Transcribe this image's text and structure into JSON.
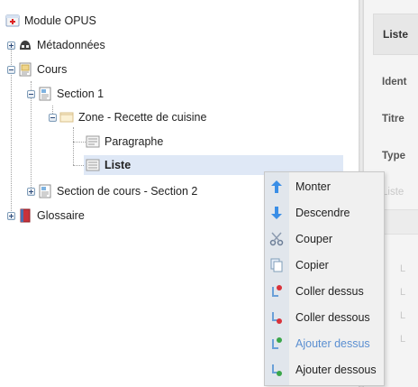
{
  "tree": {
    "root": "Module OPUS",
    "metadata": "Métadonnées",
    "cours": "Cours",
    "section1": "Section 1",
    "zone": "Zone - Recette de cuisine",
    "paragraphe": "Paragraphe",
    "liste": "Liste",
    "section2": "Section de cours - Section 2",
    "glossaire": "Glossaire"
  },
  "panel": {
    "header": "Liste",
    "field_ident": "Ident",
    "field_titre": "Titre",
    "field_type": "Type",
    "field_faint": "Liste",
    "bullet": "L"
  },
  "menu": {
    "monter": "Monter",
    "descendre": "Descendre",
    "couper": "Couper",
    "copier": "Copier",
    "coller_dessus": "Coller dessus",
    "coller_dessous": "Coller dessous",
    "ajouter_dessus": "Ajouter dessus",
    "ajouter_dessous": "Ajouter dessous"
  },
  "colors": {
    "selection": "#dfe8f6",
    "menu_highlight_text": "#5b8fd1",
    "icon_blue": "#3a8ee6",
    "icon_red": "#d9323a",
    "icon_green": "#3aa64a"
  }
}
